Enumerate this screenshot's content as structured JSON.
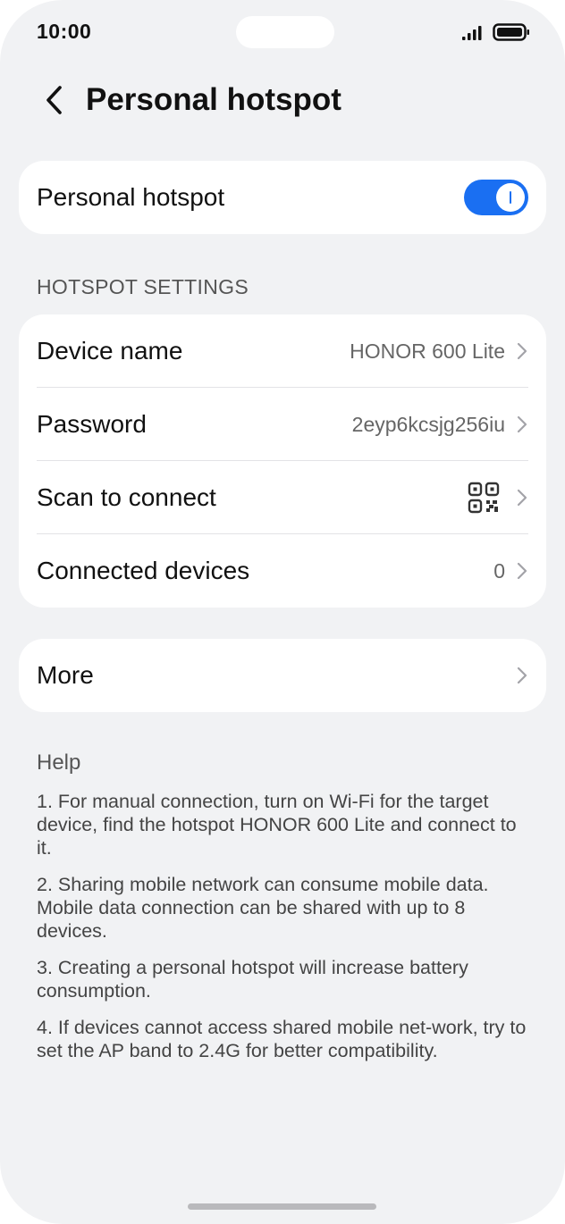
{
  "status_bar": {
    "time": "10:00"
  },
  "header": {
    "title": "Personal hotspot"
  },
  "hotspot_toggle": {
    "label": "Personal hotspot",
    "enabled": true
  },
  "settings": {
    "section_label": "HOTSPOT SETTINGS",
    "rows": [
      {
        "label": "Device name",
        "value": "HONOR 600 Lite"
      },
      {
        "label": "Password",
        "value": "2eyp6kcsjg256iu"
      },
      {
        "label": "Scan to connect",
        "value": ""
      },
      {
        "label": "Connected devices",
        "value": "0"
      }
    ]
  },
  "more": {
    "label": "More"
  },
  "help": {
    "title": "Help",
    "items": [
      "1. For manual connection, turn on Wi-Fi for the target device, find the hotspot HONOR 600 Lite and connect to it.",
      "2. Sharing mobile network can consume mobile data. Mobile data connection can be shared with up to 8 devices.",
      "3. Creating a personal hotspot will increase battery consumption.",
      "4. If devices cannot access shared mobile net-work, try to set the AP band to 2.4G for better compatibility."
    ]
  },
  "colors": {
    "accent": "#1a6ff2",
    "background": "#f1f2f4",
    "card": "#ffffff"
  },
  "icons": {
    "back": "chevron-left-icon",
    "row_arrow": "chevron-right-icon",
    "qr": "qr-code-icon",
    "signal": "signal-icon",
    "battery": "battery-icon"
  }
}
